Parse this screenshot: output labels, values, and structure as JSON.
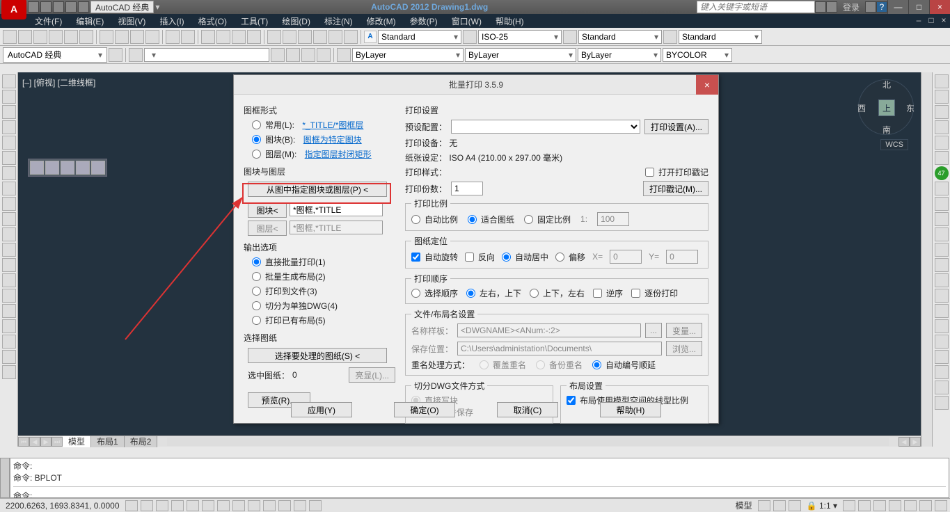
{
  "title_bar": {
    "workspace_label": "AutoCAD 经典",
    "app_title": "AutoCAD 2012    Drawing1.dwg",
    "search_placeholder": "键入关键字或短语",
    "login_label": "登录",
    "help_icon": "?",
    "min": "—",
    "max": "□",
    "close": "×"
  },
  "menus": [
    "文件(F)",
    "编辑(E)",
    "视图(V)",
    "插入(I)",
    "格式(O)",
    "工具(T)",
    "绘图(D)",
    "标注(N)",
    "修改(M)",
    "参数(P)",
    "窗口(W)",
    "帮助(H)"
  ],
  "mdi": {
    "min": "–",
    "max": "□",
    "close": "×"
  },
  "style_combos": {
    "text1": "Standard",
    "text2": "ISO-25",
    "text3": "Standard",
    "text4": "Standard"
  },
  "layer_combo": {
    "current": "ByLayer",
    "lt": "ByLayer",
    "lw": "ByLayer",
    "color": "BYCOLOR"
  },
  "workspace_row": {
    "label": "AutoCAD 经典"
  },
  "viewport": {
    "label": "[–] [俯视] [二维线框]"
  },
  "viewcube": {
    "n": "北",
    "s": "南",
    "e": "东",
    "w": "西",
    "top": "上"
  },
  "wcs": "WCS",
  "right_badge": "47",
  "tabs": {
    "model": "模型",
    "l1": "布局1",
    "l2": "布局2"
  },
  "cmd": {
    "l1": "命令:",
    "l2": "命令: BPLOT",
    "prompt": "命令:"
  },
  "status": {
    "coords": "2200.6263, 1693.8341, 0.0000",
    "scale": "1:1",
    "model": "模型"
  },
  "dialog": {
    "title": "批量打印 3.5.9",
    "close": "×",
    "frame_group": "图框形式",
    "frame_opt1": "常用(L):",
    "frame_opt1_val": "*_TITLE/*图框层",
    "frame_opt2": "图块(B):",
    "frame_opt2_val": "图框为特定图块",
    "frame_opt3": "图层(M):",
    "frame_opt3_val": "指定图层封闭矩形",
    "block_layer_group": "图块与图层",
    "pick_btn": "从图中指定图块或图层(P) <",
    "block_btn": "图块<",
    "block_val": "*图框,*TITLE",
    "layer_btn": "图层<",
    "layer_val": "*图框,*TITLE",
    "output_group": "输出选项",
    "out1": "直接批量打印(1)",
    "out2": "批量生成布局(2)",
    "out3": "打印到文件(3)",
    "out4": "切分为单独DWG(4)",
    "out5": "打印已有布局(5)",
    "select_group": "选择图纸",
    "select_btn": "选择要处理的图纸(S) <",
    "selected_lbl": "选中图纸：",
    "selected_val": "0",
    "highlight_btn": "亮显(L)...",
    "preview_btn": "预览(R)...",
    "ps_group": "打印设置",
    "preset_lbl": "预设配置：",
    "preset_btn": "打印设置(A)...",
    "device_lbl": "打印设备：",
    "device_val": "无",
    "paper_lbl": "纸张设定：",
    "paper_val": "ISO A4 (210.00 x 297.00 毫米)",
    "style_lbl": "打印样式：",
    "stamp_chk": "打开打印戳记",
    "copies_lbl": "打印份数：",
    "copies_val": "1",
    "stamp_btn": "打印戳记(M)...",
    "scale_group": "打印比例",
    "scale_auto": "自动比例",
    "scale_fit": "适合图纸",
    "scale_fix": "固定比例",
    "scale_one": "1:",
    "scale_val": "100",
    "pos_group": "图纸定位",
    "pos_rot": "自动旋转",
    "pos_rev": "反向",
    "pos_center": "自动居中",
    "pos_off": "偏移",
    "pos_x": "X=",
    "pos_y": "Y=",
    "zero": "0",
    "order_group": "打印顺序",
    "ord_sel": "选择顺序",
    "ord_lr": "左右，上下",
    "ord_ud": "上下，左右",
    "ord_rev": "逆序",
    "ord_page": "逐份打印",
    "name_group": "文件/布局名设置",
    "tpl_lbl": "名称样板：",
    "tpl_val": "<DWGNAME><ANum:-:2>",
    "tpl_btn": "...",
    "var_btn": "变量...",
    "save_lbl": "保存位置：",
    "save_val": "C:\\Users\\administation\\Documents\\",
    "browse_btn": "浏览...",
    "dup_lbl": "重名处理方式：",
    "dup_over": "覆盖重名",
    "dup_bak": "备份重名",
    "dup_auto": "自动编号顺延",
    "split_group": "切分DWG文件方式",
    "split_wb": "直接写块",
    "split_purge": "清理并保存",
    "layout_group": "布局设置",
    "layout_chk": "布局使用模型空间的线型比例",
    "apply": "应用(Y)",
    "ok": "确定(O)",
    "cancel": "取消(C)",
    "help": "帮助(H)"
  }
}
